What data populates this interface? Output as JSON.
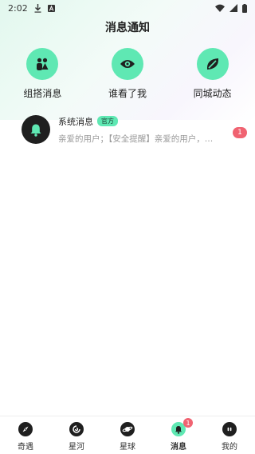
{
  "status_bar": {
    "time": "2:02",
    "icons": [
      "download-icon",
      "a-box-icon",
      "wifi-icon",
      "signal-icon",
      "battery-icon"
    ]
  },
  "header": {
    "title": "消息通知"
  },
  "quick_actions": [
    {
      "label": "组搭消息",
      "icon": "people-icon"
    },
    {
      "label": "谁看了我",
      "icon": "eye-icon"
    },
    {
      "label": "同城动态",
      "icon": "leaf-icon"
    }
  ],
  "messages": [
    {
      "name": "系统消息",
      "tag": "官方",
      "preview": "亲爱的用户；【安全提醒】亲爱的用户，…",
      "unread": "1",
      "icon": "bell-icon"
    }
  ],
  "tab_bar": {
    "tabs": [
      {
        "label": "奇遇",
        "icon": "compass-icon",
        "active": false
      },
      {
        "label": "星河",
        "icon": "galaxy-icon",
        "active": false
      },
      {
        "label": "星球",
        "icon": "planet-icon",
        "active": false
      },
      {
        "label": "消息",
        "icon": "bell-icon",
        "active": true,
        "badge": "1"
      },
      {
        "label": "我的",
        "icon": "face-icon",
        "active": false
      }
    ]
  },
  "colors": {
    "accent": "#5fe8b3",
    "badge": "#f06371",
    "dark": "#1f1f1f",
    "muted_text": "#9a9a9a"
  }
}
